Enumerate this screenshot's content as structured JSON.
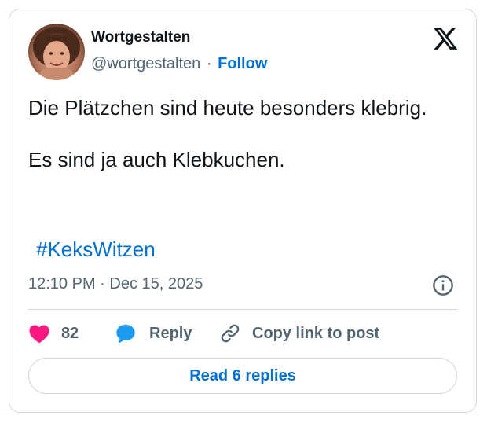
{
  "author": {
    "name": "Wortgestalten",
    "handle": "@wortgestalten",
    "separator": "·",
    "follow_label": "Follow"
  },
  "tweet": {
    "line1": "Die Plätzchen sind heute besonders klebrig.",
    "line2": "Es sind ja auch Klebkuchen.",
    "hashtag": "#KeksWitzen",
    "timestamp": "12:10 PM · Dec 15, 2025"
  },
  "actions": {
    "like_count": "82",
    "reply_label": "Reply",
    "copy_link_label": "Copy link to post"
  },
  "footer": {
    "read_replies_label": "Read 6 replies"
  },
  "icons": {
    "brand": "x-logo-icon",
    "info": "info-icon",
    "like": "heart-icon",
    "reply": "speech-bubble-icon",
    "copy": "link-icon"
  },
  "colors": {
    "link": "#006fd6",
    "secondary_text": "#536471",
    "heart": "#f91880",
    "reply_bubble": "#1d9bf0",
    "border": "#cfd9de"
  }
}
